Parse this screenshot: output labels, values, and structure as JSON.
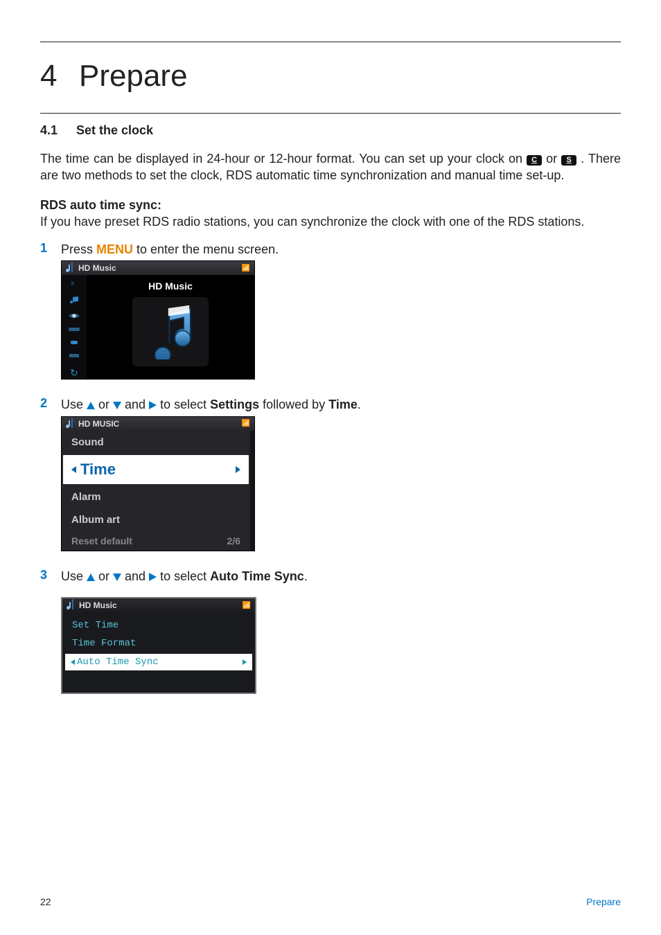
{
  "chapter": {
    "num": "4",
    "title": "Prepare"
  },
  "section": {
    "num": "4.1",
    "title": "Set the clock"
  },
  "intro": {
    "pre": "The time can be displayed in 24-hour or 12-hour format. You can set up your clock on ",
    "or": " or ",
    "post": ". There are two methods to set the clock, RDS automatic time synchronization and manual time set-up.",
    "badgeC": "C",
    "badgeS": "S"
  },
  "rds": {
    "head": "RDS auto time sync:",
    "body": "If you have preset RDS radio stations, you can synchronize the clock with one of the RDS stations."
  },
  "steps": {
    "s1": {
      "num": "1",
      "a": "Press ",
      "menu": "MENU",
      "b": " to enter the menu screen."
    },
    "s2": {
      "num": "2",
      "a": "Use ",
      "b": " or ",
      "c": " and ",
      "d": " to select ",
      "settings": "Settings",
      "e": " followed by ",
      "time": "Time",
      "f": "."
    },
    "s3": {
      "num": "3",
      "a": "Use ",
      "b": " or ",
      "c": " and ",
      "d": " to select ",
      "ats": "Auto Time Sync",
      "e": "."
    }
  },
  "shot1": {
    "titlebar": "HD Music",
    "label": "HD Music"
  },
  "shot2": {
    "titlebar": "HD MUSIC",
    "r_sound": "Sound",
    "sel": "Time",
    "r_alarm": "Alarm",
    "r_album": "Album art",
    "r_reset": "Reset default",
    "counter": "2/6"
  },
  "shot3": {
    "titlebar": "HD Music",
    "r1": "Set Time",
    "r2": "Time Format",
    "sel": "Auto Time Sync"
  },
  "footer": {
    "page": "22",
    "section": "Prepare"
  }
}
